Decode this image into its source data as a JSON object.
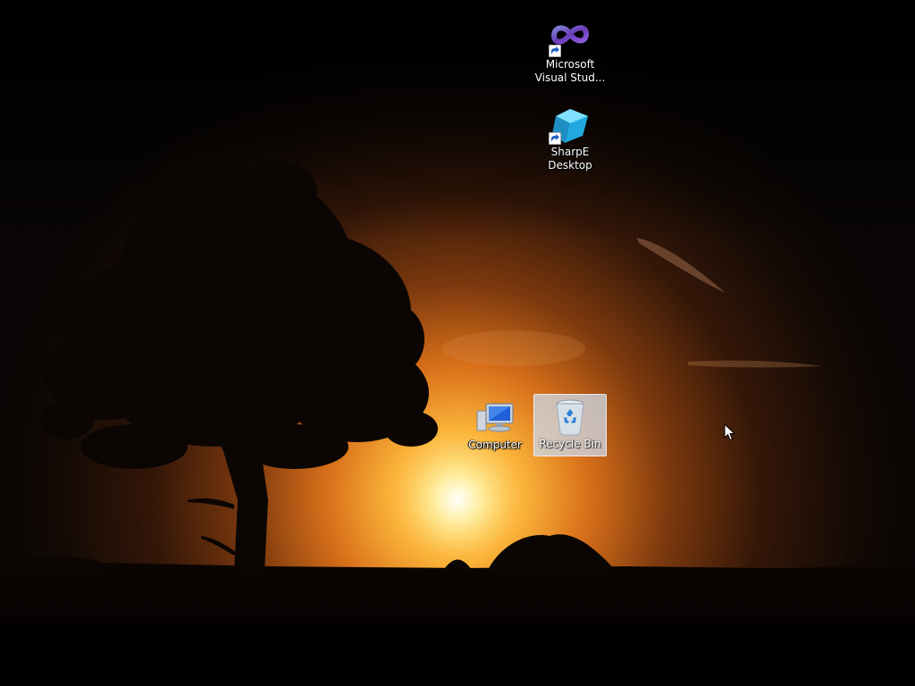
{
  "desktop": {
    "icons": [
      {
        "label": "Microsoft\nVisual Stud...",
        "icon": "visual-studio-icon",
        "shortcut": true
      },
      {
        "label": "SharpE\nDesktop",
        "icon": "sharpe-cube-icon",
        "shortcut": true
      },
      {
        "label": "Computer",
        "icon": "computer-icon",
        "shortcut": false
      },
      {
        "label": "Recycle Bin",
        "icon": "recycle-bin-icon",
        "shortcut": false,
        "selected": true
      }
    ]
  },
  "colors": {
    "sky_top": "#0c0805",
    "sky_mid": "#5a2a0a",
    "sun_glow": "#ffd35a",
    "horizon": "#e9721a",
    "ground": "#050302",
    "selection": "#cdd7e4"
  }
}
